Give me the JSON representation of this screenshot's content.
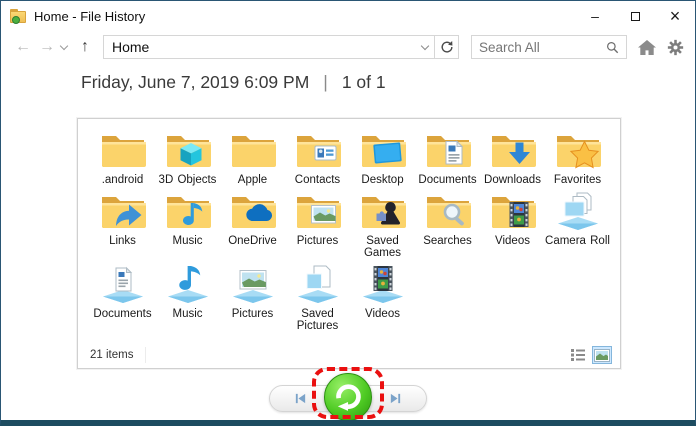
{
  "window": {
    "title": "Home - File History",
    "controls": {
      "minimize": "–",
      "close": "×"
    }
  },
  "toolbar": {
    "address_value": "Home",
    "search_placeholder": "Search All"
  },
  "header": {
    "date": "Friday, June 7, 2019 6:09 PM",
    "separator": "|",
    "position": "1 of 1"
  },
  "panel": {
    "items": [
      {
        "label": ".android",
        "icon": "folder"
      },
      {
        "label": "3D Objects",
        "icon": "folder-cube"
      },
      {
        "label": "Apple",
        "icon": "folder"
      },
      {
        "label": "Contacts",
        "icon": "folder-contacts"
      },
      {
        "label": "Desktop",
        "icon": "folder-desktop"
      },
      {
        "label": "Documents",
        "icon": "folder-document"
      },
      {
        "label": "Downloads",
        "icon": "folder-download"
      },
      {
        "label": "Favorites",
        "icon": "folder-star"
      },
      {
        "label": "Links",
        "icon": "folder-link"
      },
      {
        "label": "Music",
        "icon": "folder-music"
      },
      {
        "label": "OneDrive",
        "icon": "folder-onedrive"
      },
      {
        "label": "Pictures",
        "icon": "folder-picture"
      },
      {
        "label": "Saved Games",
        "icon": "folder-pawn"
      },
      {
        "label": "Searches",
        "icon": "folder-search"
      },
      {
        "label": "Videos",
        "icon": "folder-film"
      },
      {
        "label": "Camera Roll",
        "icon": "library-camera"
      },
      {
        "label": "Documents",
        "icon": "library-document"
      },
      {
        "label": "Music",
        "icon": "library-music"
      },
      {
        "label": "Pictures",
        "icon": "library-picture"
      },
      {
        "label": "Saved Pictures",
        "icon": "library-saved-pictures"
      },
      {
        "label": "Videos",
        "icon": "library-film"
      }
    ],
    "status": "21 items"
  },
  "colors": {
    "window_border": "#2a5674",
    "restore_green": "#3dbb1a",
    "annotation_red": "#ea1010",
    "folder_yellow": "#fbd36a"
  }
}
